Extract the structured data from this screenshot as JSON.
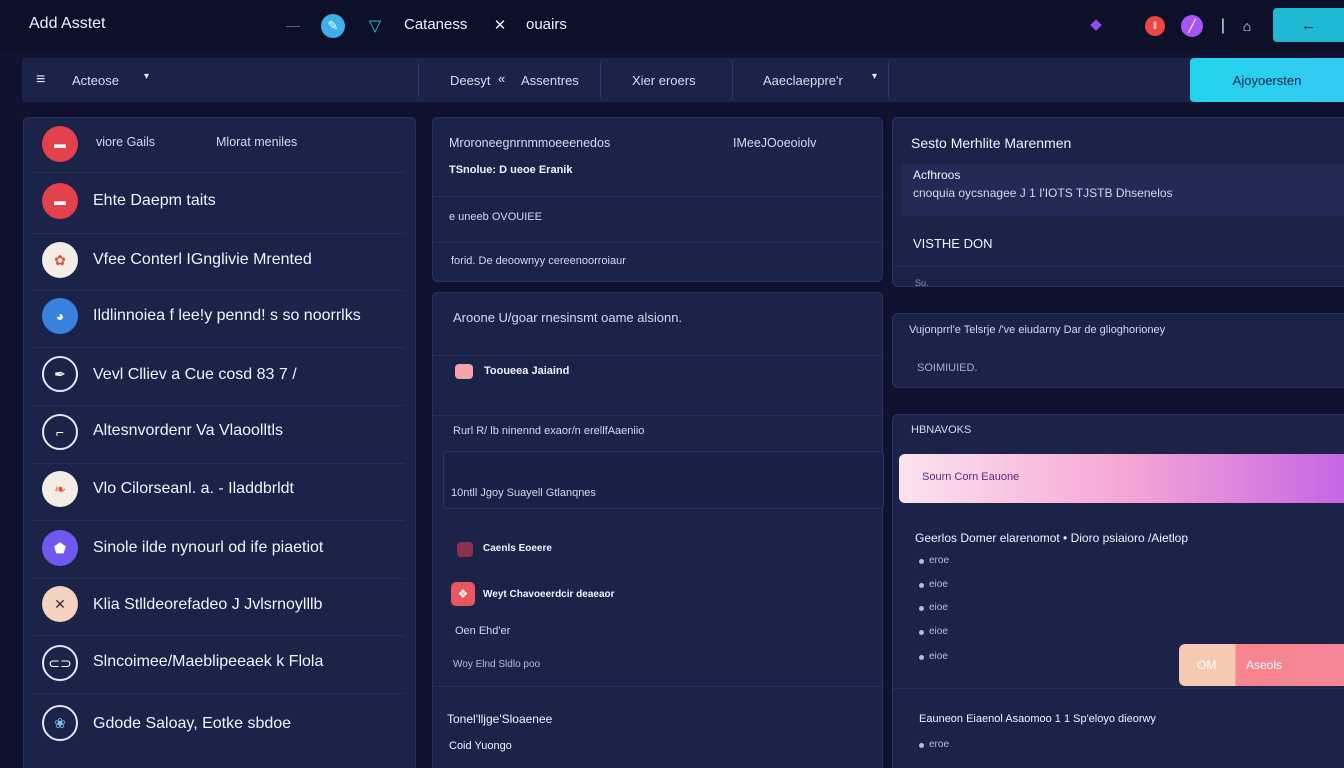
{
  "topbar": {
    "app_title": "Add Asstet",
    "item1": "Cataness",
    "item2": "ouairs",
    "icons": [
      "minus-icon",
      "brush-icon",
      "triangle-icon",
      "close-x-icon",
      "drop-icon",
      "record-icon",
      "pen-icon",
      "bar-icon",
      "tag-icon"
    ],
    "action_glyph": "←"
  },
  "secbar": {
    "menu_label": "Acteose",
    "item1": "Deesyt",
    "item2": "Assentres",
    "item3": "Xier eroers",
    "item4": "Aaeclaeppre'r",
    "cta_label": "Ajoyoersten"
  },
  "left_list": {
    "header_col1": "viore Gails",
    "header_col2": "Mlorat meniles",
    "items": [
      {
        "label": "Ehte Daepm taits",
        "icon": "minus-icon",
        "color": "#e3414c"
      },
      {
        "label": "Vfee Conterl IGnglivie Mrented",
        "icon": "flower-icon",
        "color": "#f4ede6"
      },
      {
        "label": "Ildlinnoiea f  lee!y pennd! s  so noorrlks",
        "icon": "globe-icon",
        "color": "#3a82df"
      },
      {
        "label": "Vevl Clliev  a  Cue cosd  83  7  /",
        "icon": "quill-icon",
        "color": "#1c2349"
      },
      {
        "label": "Altesnvordenr Va Vlaoolltls",
        "icon": "hook-icon",
        "color": "#1c2349"
      },
      {
        "label": "Vlo Cilorseanl. a.  - Iladdbrldt",
        "icon": "leaf-icon",
        "color": "#f4ede6"
      },
      {
        "label": "Sinole ilde nynourl od  ife piaetiot",
        "icon": "shield-icon",
        "color": "#6e58f0"
      },
      {
        "label": "Klia Stlldeorefadeo J Jvlsrnoylllb",
        "icon": "x-icon",
        "color": "#f3d3c0"
      },
      {
        "label": "Slncoimee/Maeblipeeaek  k   Flola",
        "icon": "capsule-icon",
        "color": "#1c2349"
      },
      {
        "label": "Gdode Saloay, Eotke sbdoe",
        "icon": "lotus-icon",
        "color": "#1c2349"
      }
    ]
  },
  "mid_top": {
    "col1": "Mroroneegnrnmmoeeenedos",
    "col2": "IMeeJOoeoiolv",
    "line1": "TSnolue: D  ueoe Eranik",
    "line2": "e  uneeb OVOUIEE",
    "line3": "forid.    De deoownyy cereenoorroiaur"
  },
  "mid_bottom": {
    "title": "Aroone U/goar rnesinsmt oame alsionn.",
    "item1": "Tooueea Jaiaind",
    "item2": "Rurl   R/ lb ninennd exaor/n erellfAaeniio",
    "item3": "10ntll  Jgoy Suayell Gtlanqnes",
    "item4": "Caenls  Eoeere",
    "item5": "Weyt Chavoeerdcir deaeaor",
    "item6": "Oen  Ehd'er",
    "item7": "Woy       Elnd Sldlo      poo",
    "item8": "Tonel'lljge'Sloaenee",
    "item9": "Coid Yuongo"
  },
  "right_top": {
    "title": "Sesto Merhlite Marenmen",
    "sub1": "Acfhroos",
    "sub2": "cnoquia  oycsnagee  J  1   I'IOTS  TJSTB  Dhsenelos",
    "label": "VISTHE DON",
    "foot": "Su."
  },
  "right_mid": {
    "line1": "Vujonprrl'e   Telsrje    /'ve   eiudarny      Dar de glioghorioney",
    "line2": "SOIMIUIED."
  },
  "right_bottom": {
    "header": "HBNAVOKS",
    "banner": "Sourn Corn Eauone",
    "row": "Geerlos   Domer elarenomot •      Dioro   psiaioro       /Aietlop",
    "bullets": [
      "eroe",
      "eioe",
      "eioe",
      "eioe",
      "eioe"
    ],
    "badge_left": "OM",
    "badge_right": "Aseols",
    "row2": "Eauneon      Eiaenol   Asaomoo  1 1      Sp'eloyo         dieorwy",
    "bullet_last": "eroe"
  },
  "colors": {
    "accent_cyan": "#22d3ee",
    "accent_pink": "#f472b6",
    "accent_purple": "#a855f7",
    "panel_bg": "#1c2349",
    "page_bg": "#0f1330"
  }
}
